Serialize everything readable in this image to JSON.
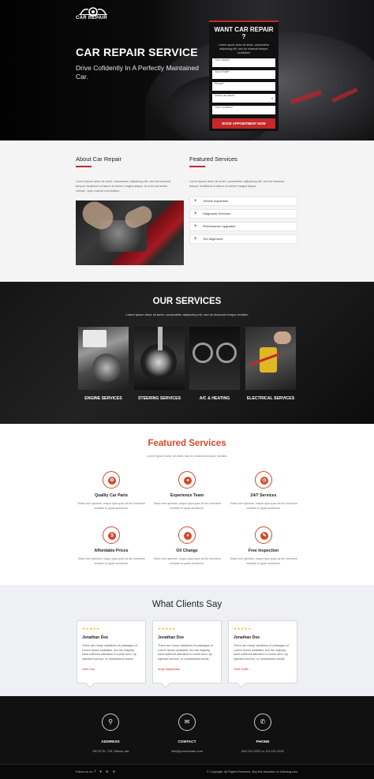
{
  "hero": {
    "logo_text": "CAR REPAIR",
    "title": "CAR REPAIR SERVICE",
    "subtitle": "Drive Cofidently In A Perfectly Maintained Car."
  },
  "form": {
    "title": "WANT CAR REPAIR ?",
    "description": "Lorem ipsum dolor sit amet, consectetur adipiscing elit, sed do eiusmod tempor incididunt",
    "name_placeholder": "Your Name*",
    "email_placeholder": "Your Email*",
    "phone_placeholder": "Phone*",
    "issue_placeholder": "Select an issue*",
    "location_placeholder": "Your Location*",
    "button": "BOOK APPOINTMENT NOW"
  },
  "about": {
    "heading": "About Car Repair",
    "text": "Lorem ipsum dolor sit amet, consectetur adipiscing elit, sed do eiusmod tempor incididunt ut labore et dolore magna aliqua. Ut enim ad minim veniam, quis nostrud exercitation."
  },
  "featured_list": {
    "heading": "Featured Services",
    "text": "Lorem ipsum dolor sit amet, consectetur adipiscing elit, sed do eiusmod tempor incididunt ut labore et dolore magna aliqua.",
    "items": [
      "Vehicle Inspection",
      "Diagnostic Services",
      "Performance Upgrades",
      "Tire Alignment"
    ]
  },
  "our_services": {
    "title": "OUR SERVICES",
    "subtitle": "Lorem ipsum dolor sit amet, consectetur adipiscing elit, sed do eiusmod tempor incididu",
    "tiles": [
      "ENGINE SERVICES",
      "STEERING SERVICES",
      "A/C & HEATING",
      "ELECTRICAL SERVICES"
    ]
  },
  "featured": {
    "title": "Featured Services",
    "subtitle": "Lorem ipsum dolor sit amet, sed do eiusmod tempor incididu",
    "item_desc": "Totam rem aperiam, eaque ipsa quae ab illo inventore veritatis et quasi architecto.",
    "items": [
      {
        "title": "Quality Car Parts",
        "icon": "gears-icon"
      },
      {
        "title": "Experience Team",
        "icon": "person-icon"
      },
      {
        "title": "24/7 Services",
        "icon": "clock-icon"
      },
      {
        "title": "Affordable Prices",
        "icon": "price-tag-icon"
      },
      {
        "title": "Oil Change",
        "icon": "oil-drop-icon"
      },
      {
        "title": "Free Inspection",
        "icon": "wrench-icon"
      }
    ]
  },
  "testimonials": {
    "title": "What Clients Say",
    "stars": "★★★★★",
    "quote": "There are many variations of passages of Lorem Ipsum available, but the majority have suffered alteration in some form, by injected humour, or randomised words.",
    "cards": [
      {
        "name": "Jonathan Doe",
        "author": "John Doe"
      },
      {
        "name": "Jonathan Doe",
        "author": "Andy Diaptarane"
      },
      {
        "name": "Jonathan Doe",
        "author": "Gold Smith"
      }
    ]
  },
  "contact": {
    "address_label": "ADDRESS",
    "address_value": "250 El Dr. 725, Manai, ala",
    "contact_label": "CONTACT",
    "contact_value": "info@yourdomain.com",
    "phone_label": "PHONE",
    "phone_value": "000-111-2222 or 111-111-2222"
  },
  "footer": {
    "follow": "Follow us on:",
    "social": "f  ♥  ✉  ⊕",
    "copyright": "© Copyright. All Rights Reserved.   Buy this template on Dlandog.com"
  },
  "colors": {
    "accent": "#c62828",
    "featured_orange": "#d2492a"
  }
}
